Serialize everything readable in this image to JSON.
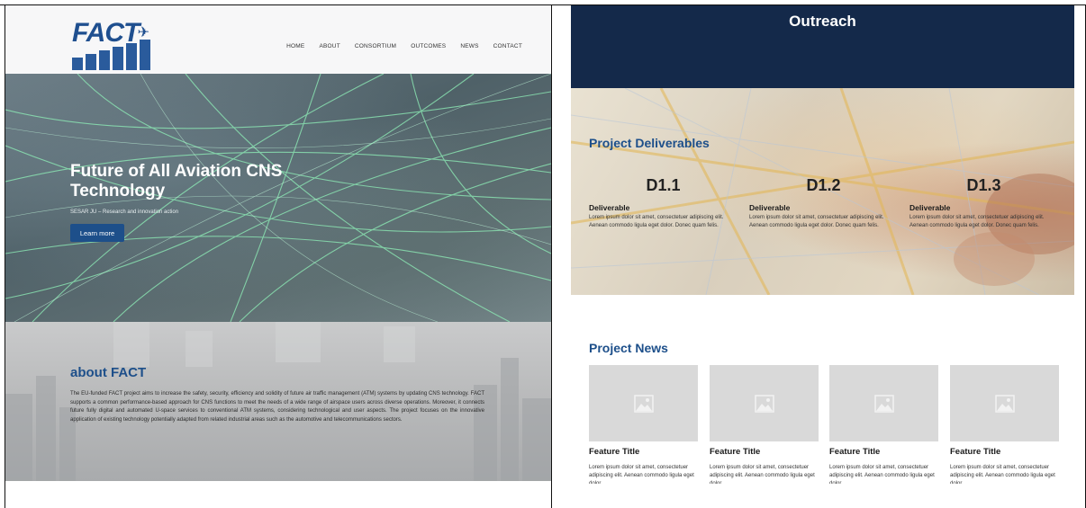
{
  "left_page": {
    "logo": {
      "text": "FACT"
    },
    "nav": [
      "HOME",
      "ABOUT",
      "CONSORTIUM",
      "OUTCOMES",
      "NEWS",
      "CONTACT"
    ],
    "hero": {
      "title": "Future of All Aviation CNS Technology",
      "subtitle": "SESAR JU – Research and innovation action",
      "button": "Learn more"
    },
    "about": {
      "title": "about FACT",
      "text": "The EU-funded FACT project aims to increase the safety, security, efficiency and solidity of future air traffic management (ATM) systems by updating CNS technology. FACT supports a common performance-based approach for CNS functions to meet the needs of a wide range of airspace users across diverse operations. Moreover, it connects future fully digital and automated U-space services to conventional ATM systems, considering technological and user aspects. The project focuses on the innovative application of existing technology potentially adapted from related industrial areas such as the automotive and telecommunications sectors."
    }
  },
  "right_page": {
    "outreach_title": "Outreach",
    "deliverables": {
      "title": "Project Deliverables",
      "items": [
        {
          "code": "D1.1",
          "label": "Deliverable",
          "text": "Lorem ipsum dolor sit amet, consectetuer adipiscing elit. Aenean commodo ligula eget dolor. Donec quam felis."
        },
        {
          "code": "D1.2",
          "label": "Deliverable",
          "text": "Lorem ipsum dolor sit amet, consectetuer adipiscing elit. Aenean commodo ligula eget dolor. Donec quam felis."
        },
        {
          "code": "D1.3",
          "label": "Deliverable",
          "text": "Lorem ipsum dolor sit amet, consectetuer adipiscing elit. Aenean commodo ligula eget dolor. Donec quam felis."
        }
      ]
    },
    "news": {
      "title": "Project News",
      "cards": [
        {
          "title": "Feature Title",
          "text": "Lorem ipsum dolor sit amet, consectetuer adipiscing elit. Aenean commodo ligula eget dolor."
        },
        {
          "title": "Feature Title",
          "text": "Lorem ipsum dolor sit amet, consectetuer adipiscing elit. Aenean commodo ligula eget dolor."
        },
        {
          "title": "Feature Title",
          "text": "Lorem ipsum dolor sit amet, consectetuer adipiscing elit. Aenean commodo ligula eget dolor."
        },
        {
          "title": "Feature Title",
          "text": "Lorem ipsum dolor sit amet, consectetuer adipiscing elit. Aenean commodo ligula eget dolor."
        }
      ],
      "image_icon": "image-placeholder-icon"
    }
  },
  "colors": {
    "brand_blue": "#1d4f8a",
    "outreach_navy": "#14294a",
    "card_gray": "#d9d9d9"
  }
}
